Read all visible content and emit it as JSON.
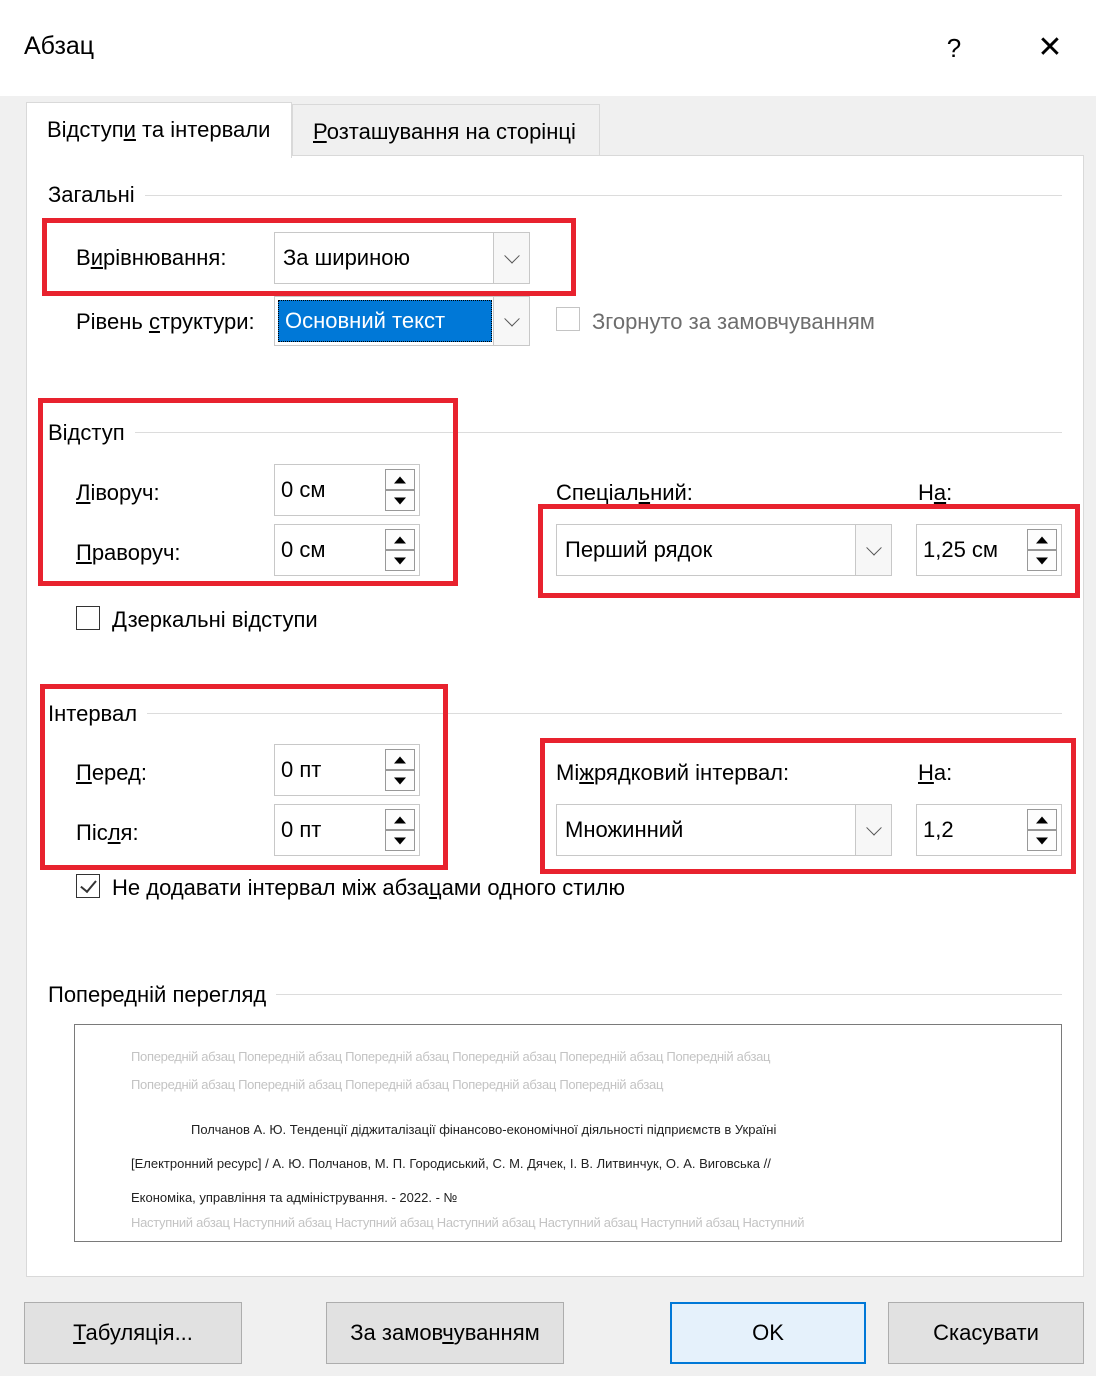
{
  "window": {
    "title": "Абзац",
    "help": "?",
    "close": "✕"
  },
  "tabs": [
    {
      "label_pre": "Відступ",
      "label_ul": "и",
      "label_post": " та інтервали"
    },
    {
      "label_pre": "",
      "label_ul": "Р",
      "label_post": "озташування на сторінці"
    }
  ],
  "general": {
    "title": "Загальні",
    "alignment_label_pre": "В",
    "alignment_label_ul": "и",
    "alignment_label_post": "рівнювання:",
    "alignment_value": "За шириною",
    "outline_label_pre": "Рівень ",
    "outline_label_ul": "с",
    "outline_label_post": "труктури:",
    "outline_value": "Основний текст",
    "collapsed_label": "Згорнуто за замовчуванням"
  },
  "indent": {
    "title": "Відступ",
    "left_label_pre": "",
    "left_label_ul": "Л",
    "left_label_post": "іворуч:",
    "left_value": "0 см",
    "right_label_pre": "",
    "right_label_ul": "П",
    "right_label_post": "раворуч:",
    "right_value": "0 см",
    "special_label_pre": "Спеціал",
    "special_label_ul": "ь",
    "special_label_post": "ний:",
    "special_value": "Перший рядок",
    "by_label_pre": "Н",
    "by_label_ul": "а",
    "by_label_post": ":",
    "by_value": "1,25 см",
    "mirror_label_pre": "",
    "mirror_label_ul": "Д",
    "mirror_label_post": "зеркальні відступи"
  },
  "spacing": {
    "title": "Інтервал",
    "before_label_pre": "",
    "before_label_ul": "П",
    "before_label_post": "еред:",
    "before_value": "0 пт",
    "after_label_pre": "Піс",
    "after_label_ul": "л",
    "after_label_post": "я:",
    "after_value": "0 пт",
    "line_label_pre": "Мі",
    "line_label_ul": "ж",
    "line_label_post": "рядковий інтервал:",
    "line_value": "Множинний",
    "at_label_pre": "",
    "at_label_ul": "Н",
    "at_label_post": "а:",
    "at_value": "1,2",
    "dont_add_pre": "Не додавати інтервал між абза",
    "dont_add_ul": "ц",
    "dont_add_post": "ами одного стилю"
  },
  "preview": {
    "title": "Попередній перегляд",
    "prev_line1": "Попередній абзац Попередній абзац Попередній абзац Попередній абзац Попередній абзац Попередній абзац",
    "prev_line2": "Попередній абзац Попередній абзац Попередній абзац Попередній абзац Попередній абзац",
    "main_line1": "Полчанов  А.  Ю.  Тенденції  діджиталізації  фінансово-економічної  діяльності  підприємств  в  Україні",
    "main_line2": "[Електронний  ресурс]  /  А.  Ю.  Полчанов,  М.  П.  Городиський,  С.  М.  Дячек,  І.  В.  Литвинчук,  О.  А.  Виговська  //",
    "main_line3": "Економіка, управління та адміністрування. - 2022. - №",
    "next_line1": "Наступний абзац Наступний абзац Наступний абзац Наступний абзац Наступний абзац Наступний абзац Наступний"
  },
  "buttons": {
    "tabs_pre": "",
    "tabs_ul": "Т",
    "tabs_post": "абуляція...",
    "default_pre": "За замов",
    "default_ul": "ч",
    "default_post": "уванням",
    "ok": "OK",
    "cancel": "Скасувати"
  },
  "colors": {
    "highlight": "#e8222e",
    "selection": "#0078d7",
    "ok_border": "#0078d7"
  }
}
